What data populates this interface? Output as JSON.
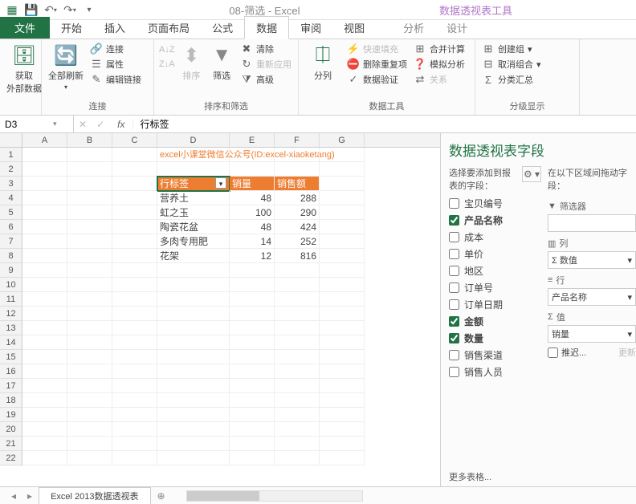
{
  "titlebar": {
    "doc": "08-筛选 - Excel",
    "context_title": "数据透视表工具"
  },
  "tabs": {
    "file": "文件",
    "home": "开始",
    "insert": "插入",
    "layout": "页面布局",
    "formulas": "公式",
    "data": "数据",
    "review": "审阅",
    "view": "视图",
    "analyze": "分析",
    "design": "设计"
  },
  "ribbon": {
    "get_data": "获取\n外部数据",
    "refresh_all": "全部刷新",
    "connections": "连接",
    "properties": "属性",
    "edit_links": "编辑链接",
    "conn_group": "连接",
    "sort": "排序",
    "filter": "筛选",
    "clear": "清除",
    "reapply": "重新应用",
    "advanced": "高级",
    "sort_filter_group": "排序和筛选",
    "text_cols": "分列",
    "flash_fill": "快速填充",
    "remove_dup": "删除重复项",
    "data_valid": "数据验证",
    "consolidate": "合并计算",
    "whatif": "模拟分析",
    "relations": "关系",
    "data_tools_group": "数据工具",
    "group": "创建组",
    "ungroup": "取消组合",
    "subtotal": "分类汇总",
    "outline_group": "分级显示"
  },
  "namebox": "D3",
  "formula": "行标签",
  "cols": [
    "A",
    "B",
    "C",
    "D",
    "E",
    "F",
    "G"
  ],
  "note": "excel小课堂微信公众号(ID:excel-xiaoketang)",
  "pivot": {
    "row_label": "行标签",
    "qty": "销量",
    "amt": "销售额",
    "rows": [
      {
        "n": "营养土",
        "q": 48,
        "a": 288
      },
      {
        "n": "虹之玉",
        "q": 100,
        "a": 290
      },
      {
        "n": "陶瓷花盆",
        "q": 48,
        "a": 424
      },
      {
        "n": "多肉专用肥",
        "q": 14,
        "a": 252
      },
      {
        "n": "花架",
        "q": 12,
        "a": 816
      }
    ]
  },
  "taskpane": {
    "title": "数据透视表字段",
    "choose": "选择要添加到报表的字段：",
    "areas_instr": "在以下区域间拖动字段：",
    "fields": [
      {
        "n": "宝贝编号",
        "c": false
      },
      {
        "n": "产品名称",
        "c": true
      },
      {
        "n": "成本",
        "c": false
      },
      {
        "n": "单价",
        "c": false
      },
      {
        "n": "地区",
        "c": false
      },
      {
        "n": "订单号",
        "c": false
      },
      {
        "n": "订单日期",
        "c": false
      },
      {
        "n": "金额",
        "c": true
      },
      {
        "n": "数量",
        "c": true
      },
      {
        "n": "销售渠道",
        "c": false
      },
      {
        "n": "销售人员",
        "c": false
      }
    ],
    "more": "更多表格...",
    "filters": "筛选器",
    "columns": "列",
    "rows_a": "行",
    "values": "值",
    "col_val": "Σ 数值",
    "row_val": "产品名称",
    "val_val": "销量",
    "defer": "推迟...",
    "update": "更新"
  },
  "sheet_tab": "Excel 2013数据透视表"
}
